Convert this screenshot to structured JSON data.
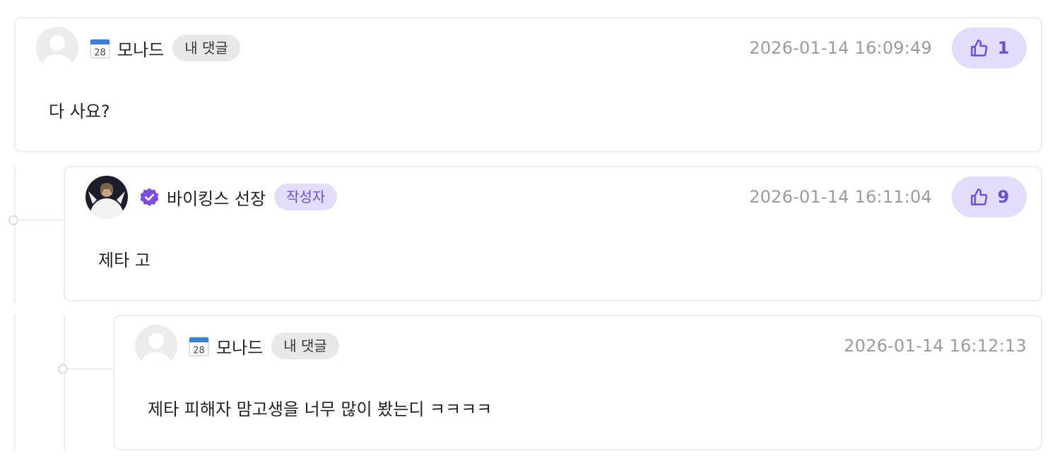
{
  "comments": [
    {
      "author": "모나드",
      "author_icon": "calendar-icon",
      "calendar_day": "28",
      "badge": "내 댓글",
      "timestamp": "2026-01-14 16:09:49",
      "likes": "1",
      "text": "다 사요?"
    },
    {
      "author": "바이킹스 선장",
      "author_icon": "verified-check-icon",
      "badge": "작성자",
      "timestamp": "2026-01-14 16:11:04",
      "likes": "9",
      "text": "제타 고"
    },
    {
      "author": "모나드",
      "author_icon": "calendar-icon",
      "calendar_day": "28",
      "badge": "내 댓글",
      "timestamp": "2026-01-14 16:12:13",
      "text": "제타 피해자 맘고생을 너무 많이 봤는디 ㅋㅋㅋㅋ"
    }
  ],
  "colors": {
    "accent": "#6d4fd6",
    "accent_bg": "#e4dcfb",
    "border": "#ececf0",
    "muted_text": "#9b9b9f",
    "badge_bg": "#e8e8ea"
  }
}
